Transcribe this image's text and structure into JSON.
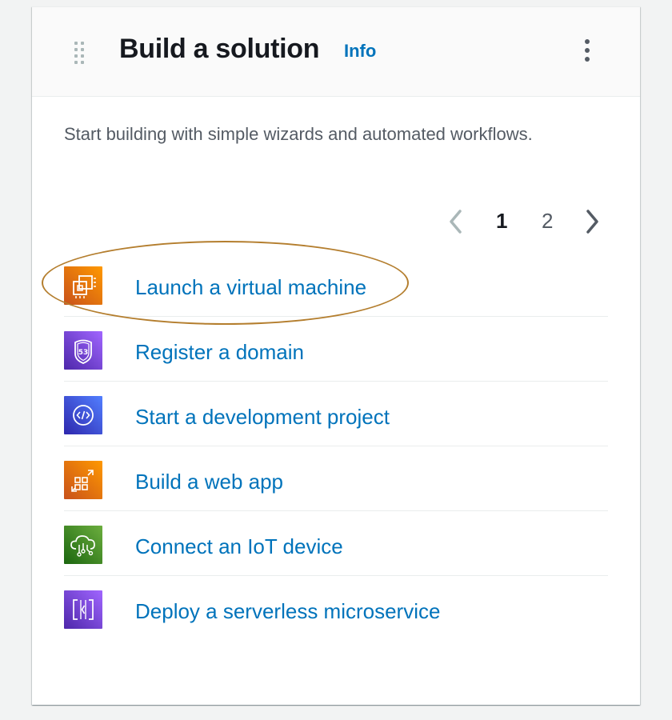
{
  "widget": {
    "title": "Build a solution",
    "info_label": "Info",
    "description": "Start building with simple wizards and automated workflows."
  },
  "pagination": {
    "current_page": "1",
    "next_page": "2",
    "prev_icon": "chevron-left-icon",
    "next_icon": "chevron-right-icon"
  },
  "solutions": [
    {
      "label": "Launch a virtual machine",
      "icon": "ec2-instance-icon",
      "color": "#e7711b"
    },
    {
      "label": "Register a domain",
      "icon": "route53-shield-icon",
      "color": "#8c4fff"
    },
    {
      "label": "Start a development project",
      "icon": "code-icon",
      "color": "#3b48cc"
    },
    {
      "label": "Build a web app",
      "icon": "web-app-icon",
      "color": "#e7711b"
    },
    {
      "label": "Connect an IoT device",
      "icon": "iot-cloud-icon",
      "color": "#3f8624"
    },
    {
      "label": "Deploy a serverless microservice",
      "icon": "serverless-icon",
      "color": "#8c4fff"
    }
  ]
}
